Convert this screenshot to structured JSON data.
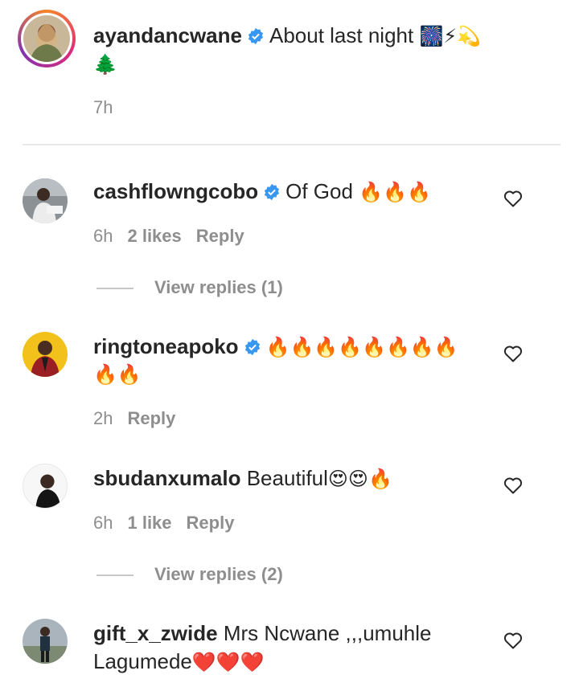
{
  "post": {
    "username": "ayandancwane",
    "caption": "About last night",
    "caption_emojis": "🎆⚡💫",
    "caption_emoji_line2": "🌲",
    "time": "7h"
  },
  "comments": [
    {
      "username": "cashflowngcobo",
      "verified": true,
      "text": "Of God",
      "emojis": "🔥🔥🔥",
      "time": "6h",
      "likes": "2 likes",
      "reply": "Reply",
      "view_replies": "View replies (1)"
    },
    {
      "username": "ringtoneapoko",
      "verified": true,
      "text": "",
      "emojis": "🔥🔥🔥🔥🔥🔥🔥🔥",
      "emojis_line2": "🔥🔥",
      "time": "2h",
      "reply": "Reply"
    },
    {
      "username": "sbudanxumalo",
      "verified": false,
      "text": "Beautiful",
      "emojis": "😍😍🔥",
      "time": "6h",
      "likes": "1 like",
      "reply": "Reply",
      "view_replies": "View replies (2)"
    },
    {
      "username": "gift_x_zwide",
      "verified": false,
      "text": "Mrs Ncwane ,,,umuhle",
      "text_line2": "Lagumede",
      "emojis_line2": "❤️❤️❤️"
    }
  ],
  "colors": {
    "verified_blue": "#3897f0",
    "meta_gray": "#8e8e8e",
    "text_dark": "#262626"
  }
}
